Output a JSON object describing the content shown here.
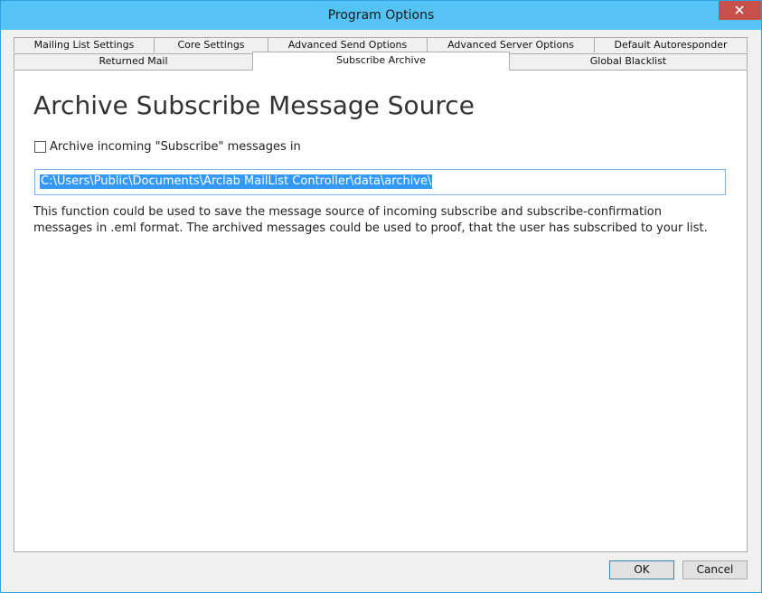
{
  "window": {
    "title": "Program Options"
  },
  "tabs": {
    "row1": [
      "Mailing List Settings",
      "Core Settings",
      "Advanced Send Options",
      "Advanced Server Options",
      "Default Autoresponder"
    ],
    "row2": [
      "Returned Mail",
      "Subscribe Archive",
      "Global Blacklist"
    ],
    "active": "Subscribe Archive"
  },
  "panel": {
    "heading": "Archive Subscribe Message Source",
    "checkbox_label": "Archive incoming \"Subscribe\" messages in",
    "checkbox_checked": false,
    "path_value": "C:\\Users\\Public\\Documents\\Arclab MailList Controller\\data\\archive\\",
    "description": "This function could be used to save the message source of incoming subscribe and subscribe-confirmation messages in .eml format. The archived messages could be used to proof, that the user has subscribed to your list."
  },
  "buttons": {
    "ok": "OK",
    "cancel": "Cancel"
  },
  "colors": {
    "titlebar": "#55c3f5",
    "close": "#c7504a",
    "selection": "#3399ff"
  }
}
